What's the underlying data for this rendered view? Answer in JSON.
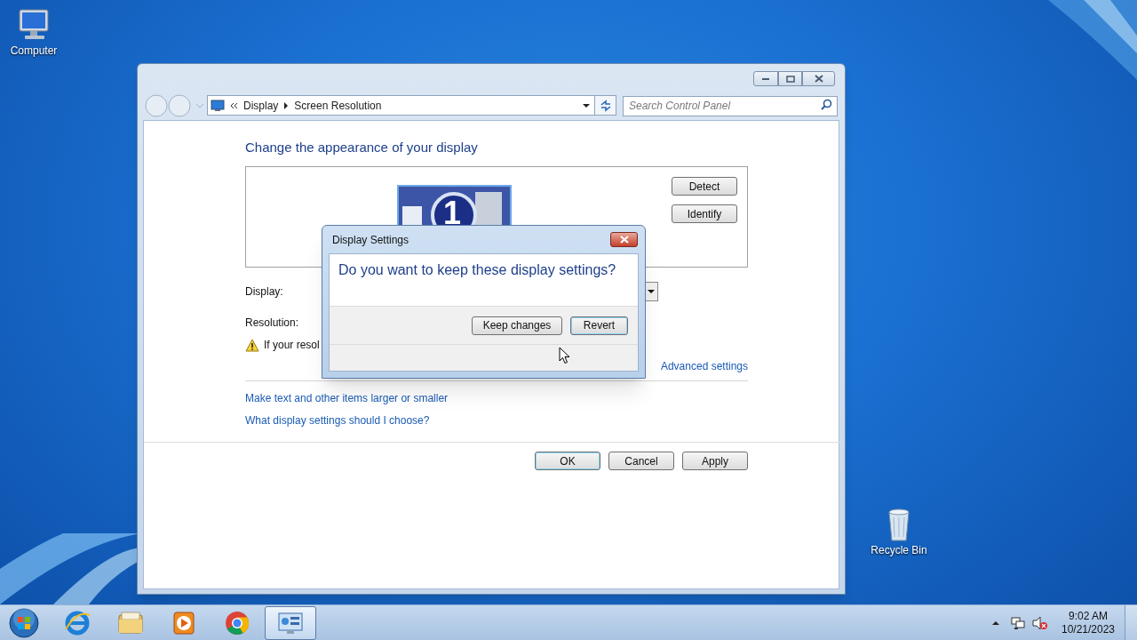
{
  "desktop_icons": [
    {
      "label": "Computer",
      "kind": "computer"
    },
    {
      "label": "Recycle Bin",
      "kind": "recycle-bin"
    }
  ],
  "window": {
    "breadcrumb": [
      "Display",
      "Screen Resolution"
    ],
    "search": {
      "placeholder": "Search Control Panel"
    },
    "heading": "Change the appearance of your display",
    "monitor_number": "1",
    "monitor_buttons": [
      "Detect",
      "Identify"
    ],
    "fields": [
      {
        "label": "Display:",
        "kind": "dropdown"
      },
      {
        "label": "Resolution:",
        "kind": "hidden"
      }
    ],
    "warning": "If your resol",
    "advanced_link": "Advanced settings",
    "links": [
      "Make text and other items larger or smaller",
      "What display settings should I choose?"
    ],
    "buttons": [
      {
        "label": "OK",
        "default": true
      },
      {
        "label": "Cancel",
        "default": false
      },
      {
        "label": "Apply",
        "default": false
      }
    ]
  },
  "dialog": {
    "title": "Display Settings",
    "question": "Do you want to keep these display settings?",
    "buttons": [
      {
        "label": "Keep changes",
        "default": false
      },
      {
        "label": "Revert",
        "default": true
      }
    ]
  },
  "taskbar": {
    "apps": [
      {
        "kind": "ie",
        "active": false
      },
      {
        "kind": "explorer",
        "active": false
      },
      {
        "kind": "media",
        "active": false
      },
      {
        "kind": "chrome",
        "active": false
      },
      {
        "kind": "control-panel",
        "active": true
      }
    ],
    "clock": {
      "time": "9:02 AM",
      "date": "10/21/2023"
    }
  }
}
